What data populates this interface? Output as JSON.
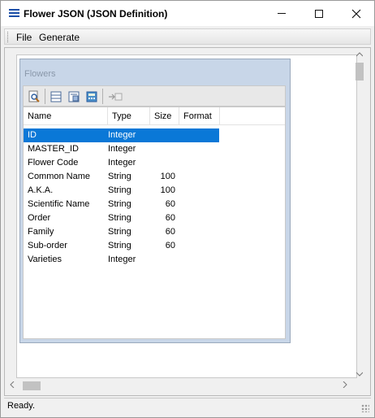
{
  "window": {
    "title": "Flower JSON (JSON Definition)",
    "controls": {
      "minimize": "—",
      "maximize": "☐",
      "close": "✕"
    }
  },
  "menu": {
    "file": "File",
    "generate": "Generate"
  },
  "child": {
    "title": "Flowers",
    "toolbar": [
      {
        "name": "preview-icon"
      },
      {
        "name": "grid-view-icon"
      },
      {
        "name": "form-view-icon"
      },
      {
        "name": "calculator-icon"
      },
      {
        "name": "goto-icon"
      }
    ],
    "columns": [
      "Name",
      "Type",
      "Size",
      "Format"
    ],
    "rows": [
      {
        "name": "ID",
        "type": "Integer",
        "size": "",
        "format": ""
      },
      {
        "name": "MASTER_ID",
        "type": "Integer",
        "size": "",
        "format": ""
      },
      {
        "name": "Flower Code",
        "type": "Integer",
        "size": "",
        "format": ""
      },
      {
        "name": "Common Name",
        "type": "String",
        "size": "100",
        "format": ""
      },
      {
        "name": "A.K.A.",
        "type": "String",
        "size": "100",
        "format": ""
      },
      {
        "name": "Scientific Name",
        "type": "String",
        "size": "60",
        "format": ""
      },
      {
        "name": "Order",
        "type": "String",
        "size": "60",
        "format": ""
      },
      {
        "name": "Family",
        "type": "String",
        "size": "60",
        "format": ""
      },
      {
        "name": "Sub-order",
        "type": "String",
        "size": "60",
        "format": ""
      },
      {
        "name": "Varieties",
        "type": "Integer",
        "size": "",
        "format": ""
      }
    ],
    "selected_row": 0
  },
  "status": {
    "text": "Ready."
  },
  "colors": {
    "selection": "#0a78d7",
    "title_icon": "#1c4fa8"
  }
}
